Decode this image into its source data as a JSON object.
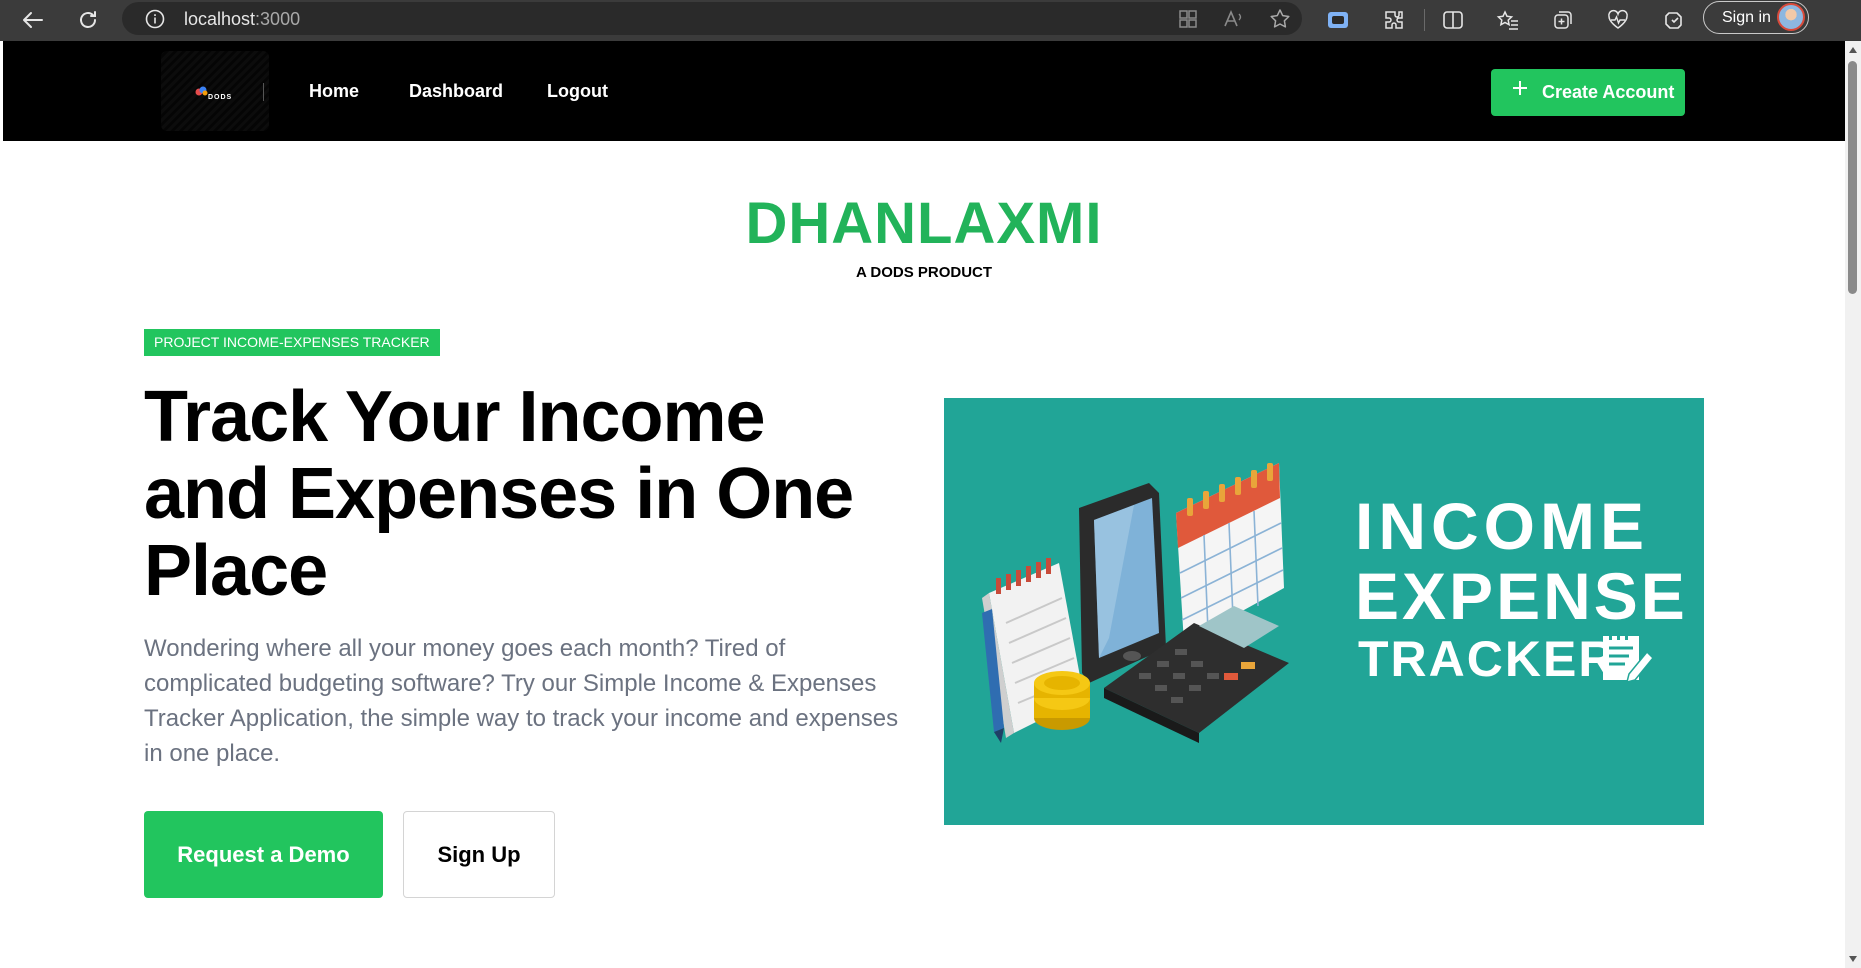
{
  "browser": {
    "url_host": "localhost",
    "url_port": ":3000",
    "signin_label": "Sign in"
  },
  "navbar": {
    "logo_text": "DODS",
    "links": [
      "Home",
      "Dashboard",
      "Logout"
    ],
    "create_account_label": "Create Account"
  },
  "brand": {
    "title": "DHANLAXMI",
    "subtitle": "A DODS PRODUCT"
  },
  "hero": {
    "tag": "PROJECT INCOME-EXPENSES TRACKER",
    "title": "Track Your Income and Expenses in One Place",
    "description": "Wondering where all your money goes each month? Tired of complicated budgeting software? Try our Simple Income & Expenses Tracker Application, the simple way to track your income and expenses in one place.",
    "demo_button": "Request a Demo",
    "signup_button": "Sign Up"
  },
  "hero_image": {
    "line1": "INCOME",
    "line2": "EXPENSE",
    "line3": "TRACKER"
  },
  "colors": {
    "accent": "#22c55e",
    "brand_title": "#22b35a",
    "image_bg": "#21a597",
    "navbar_bg": "#000000"
  },
  "icons": [
    "back-arrow-icon",
    "refresh-icon",
    "info-icon",
    "app-grid-icon",
    "read-aloud-icon",
    "favorite-star-icon",
    "extension-icon",
    "split-screen-icon",
    "favorites-list-icon",
    "collections-icon",
    "health-icon",
    "copilot-icon",
    "plus-icon",
    "notepad-pen-icon"
  ]
}
